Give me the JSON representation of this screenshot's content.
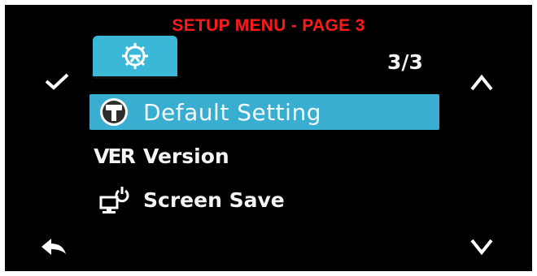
{
  "caption": "SETUP MENU - PAGE 3",
  "tab": {
    "icon": "gear-icon"
  },
  "page_indicator": "3/3",
  "side_buttons": {
    "confirm": "checkmark-icon",
    "back": "back-arrow-icon",
    "up": "chevron-up-icon",
    "down": "chevron-down-icon"
  },
  "menu": {
    "items": [
      {
        "label": "Default Setting",
        "icon": "hammer-circle-icon",
        "selected": true
      },
      {
        "label": "Version",
        "icon": "ver-icon",
        "icon_text": "VER",
        "selected": false
      },
      {
        "label": "Screen Save",
        "icon": "monitor-power-icon",
        "selected": false
      }
    ]
  },
  "colors": {
    "highlight": "#3aaed0",
    "caption": "#ff1a1a",
    "background": "#000000"
  }
}
